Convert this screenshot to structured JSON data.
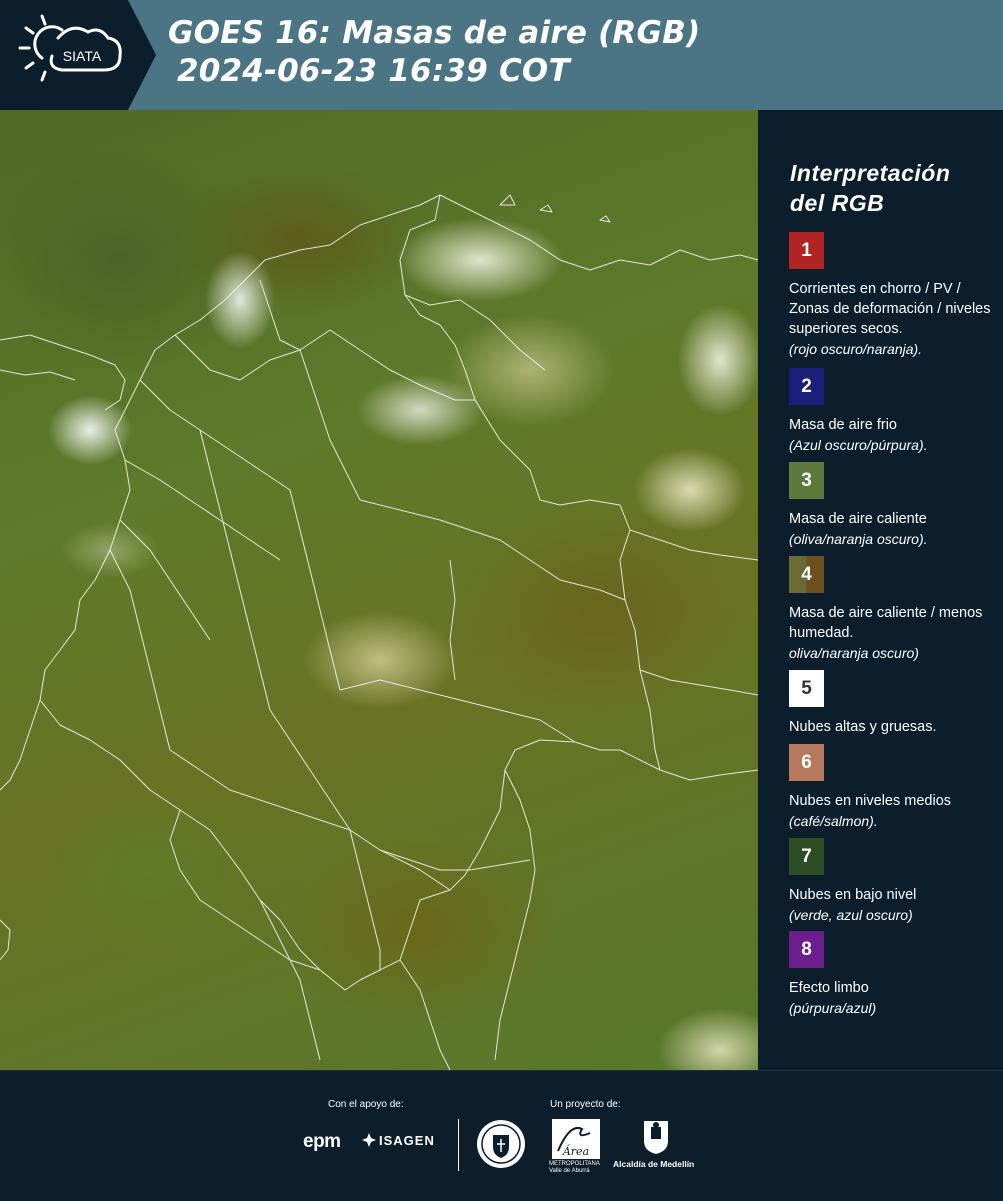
{
  "header": {
    "logo_text": "SIATA",
    "title_line1": "GOES 16: Masas de aire (RGB)",
    "title_line2": "2024-06-23 16:39 COT"
  },
  "legend": {
    "title_line1": "Interpretación",
    "title_line2": "del RGB",
    "items": [
      {
        "number": "1",
        "color": "#b02424",
        "text": "Corrientes en chorro / PV / Zonas de deformación / niveles superiores secos.",
        "sub": "(rojo oscuro/naranja)."
      },
      {
        "number": "2",
        "color": "#1a1f7a",
        "text": "Masa de aire frio",
        "sub": "(Azul oscuro/púrpura)."
      },
      {
        "number": "3",
        "color": "#5d7a3c",
        "text": "Masa de aire caliente",
        "sub": "(oliva/naranja oscuro)."
      },
      {
        "number": "4",
        "color": "#6b5a26",
        "text": "Masa de aire caliente / menos humedad.",
        "sub": "oliva/naranja oscuro)"
      },
      {
        "number": "5",
        "color": "#ffffff",
        "text": "Nubes altas y gruesas.",
        "sub": ""
      },
      {
        "number": "6",
        "color": "#b57a5e",
        "text": "Nubes en niveles medios",
        "sub": "(café/salmon)."
      },
      {
        "number": "7",
        "color": "#2f4d24",
        "text": "Nubes en bajo nivel",
        "sub": "(verde, azul oscuro)"
      },
      {
        "number": "8",
        "color": "#6b1f8f",
        "text": "Efecto limbo",
        "sub": "(púrpura/azul)"
      }
    ]
  },
  "footer": {
    "support_label": "Con el apoyo de:",
    "project_label": "Un proyecto de:",
    "epm": "epm",
    "isagen": "ISAGEN",
    "area_script": "Área",
    "area_label_line1": "METROPOLITANA",
    "area_label_line2": "Valle de Aburrá",
    "alcaldia": "Alcaldía de Medellín"
  }
}
